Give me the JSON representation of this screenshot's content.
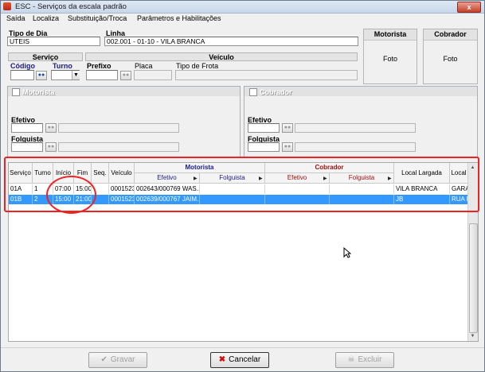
{
  "window": {
    "title": "ESC - Serviços da escala padrão",
    "close_label": "x"
  },
  "menu": [
    "Saída",
    "Localiza",
    "Substituição/Troca",
    "Parâmetros e Habilitações"
  ],
  "tipo_dia": {
    "label": "Tipo de Dia",
    "value": "UTEIS"
  },
  "linha": {
    "label": "Linha",
    "value": "002.001 - 01-10 - VILA BRANCA"
  },
  "servico": {
    "header": "Serviço",
    "codigo_label": "Código",
    "turno_label": "Turno",
    "codigo_value": "",
    "turno_value": ""
  },
  "veiculo": {
    "header": "Veículo",
    "prefixo_label": "Prefixo",
    "placa_label": "Placa",
    "tipo_frota_label": "Tipo de Frota"
  },
  "photos": {
    "motorista_header": "Motorista",
    "cobrador_header": "Cobrador",
    "foto_label": "Foto"
  },
  "motorista_panel": {
    "title": "Motorista",
    "efetivo_label": "Efetivo",
    "folguista_label": "Folguista"
  },
  "cobrador_panel": {
    "title": "Cobrador",
    "efetivo_label": "Efetivo",
    "folguista_label": "Folguista"
  },
  "grid": {
    "columns": [
      "Serviço",
      "Turno",
      "Início",
      "Fim",
      "Seq.",
      "Veículo"
    ],
    "group_motorista": "Motorista",
    "group_cobrador": "Cobrador",
    "sub_efetivo": "Efetivo",
    "sub_folguista": "Folguista",
    "local_largada": "Local Largada",
    "local_extra": "Local",
    "rows": [
      {
        "servico": "01A",
        "turno": "1",
        "inicio": "07:00",
        "fim": "15:00",
        "seq": "",
        "veiculo": "0001523",
        "mot_efetivo": "002643/000769 WAS...",
        "mot_folguista": "",
        "cob_efetivo": "",
        "cob_folguista": "",
        "local_largada": "VILA BRANCA",
        "local_extra": "GARA"
      },
      {
        "servico": "01B",
        "turno": "2",
        "inicio": "15:00",
        "fim": "21:00",
        "seq": "",
        "veiculo": "0001523",
        "mot_efetivo": "002639/000767 JAIM...",
        "mot_folguista": "",
        "cob_efetivo": "",
        "cob_folguista": "",
        "local_largada": "JB",
        "local_extra": "RUA R"
      }
    ]
  },
  "buttons": {
    "gravar": "Gravar",
    "cancelar": "Cancelar",
    "excluir": "Excluir"
  },
  "colors": {
    "highlight": "#e22222",
    "selection": "#3399ff",
    "motorista_header": "#1a1a8c",
    "cobrador_header": "#a01010"
  }
}
